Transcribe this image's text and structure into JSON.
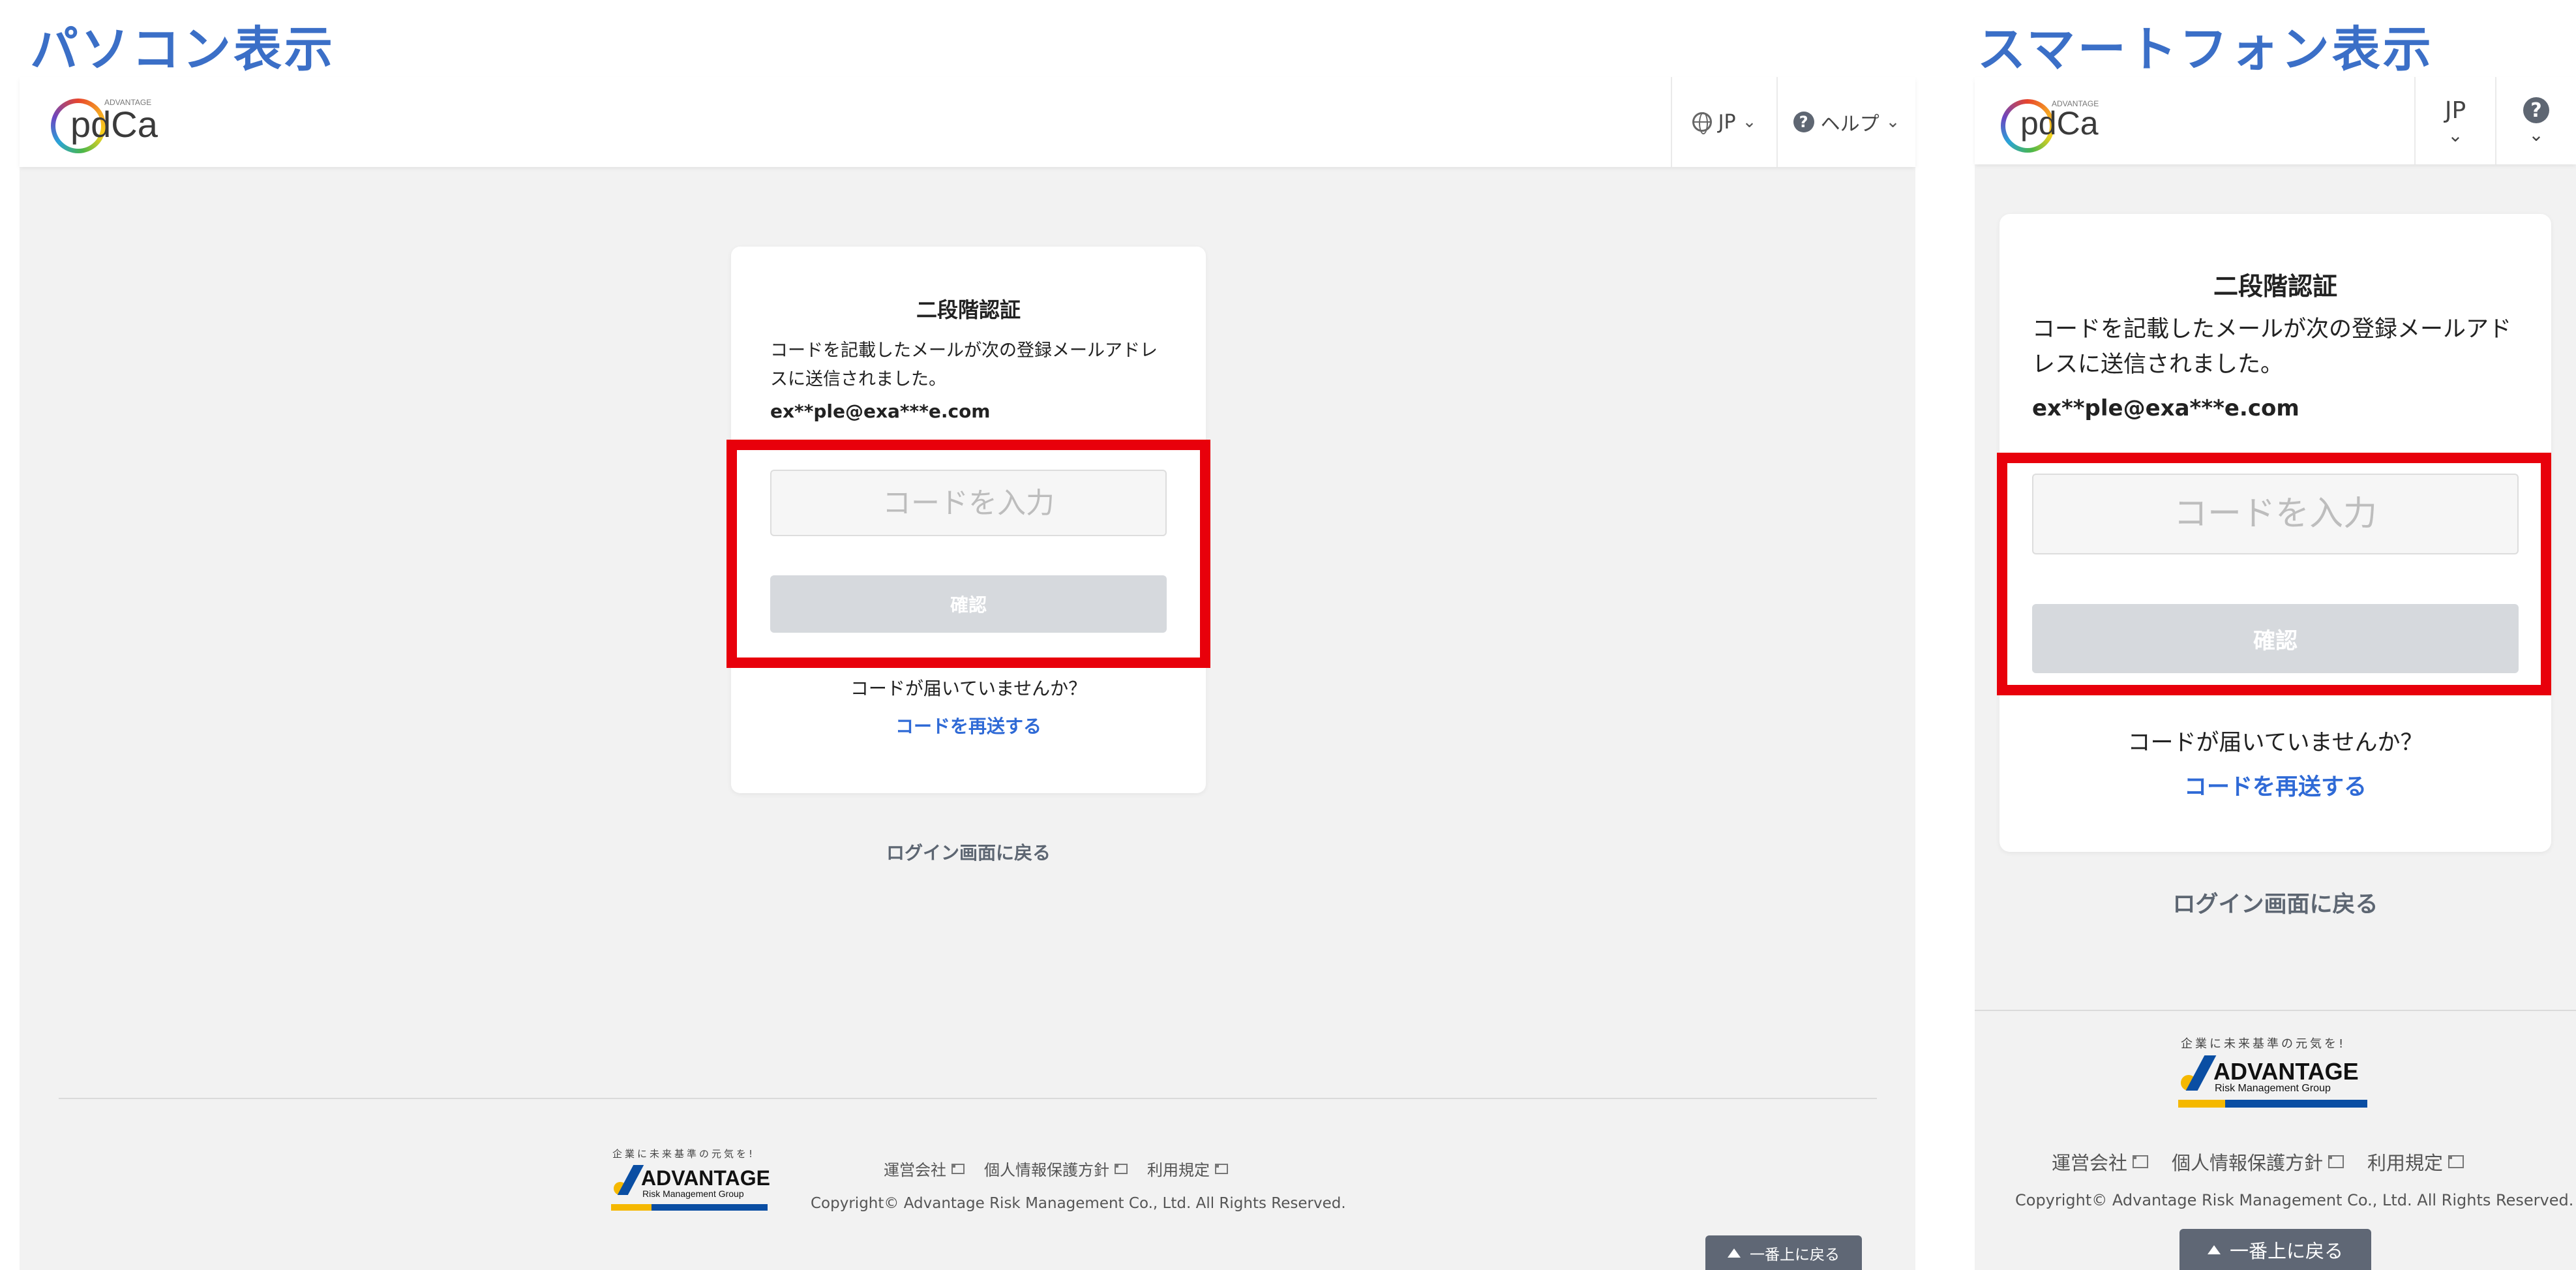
{
  "sections": {
    "pc_title": "パソコン表示",
    "sp_title": "スマートフォン表示"
  },
  "header": {
    "logo_text": "pdCa",
    "logo_tag": "ADVANTAGE",
    "language_label": "JP",
    "help_label": "ヘルプ",
    "help_icon_glyph": "?",
    "chevron_glyph": "⌄"
  },
  "auth": {
    "title": "二段階認証",
    "description": "コードを記載したメールが次の登録メールアドレスに送信されました。",
    "email": "ex**ple@exa***e.com",
    "code_placeholder": "コードを入力",
    "code_value": "",
    "confirm_label": "確認",
    "no_code_text": "コードが届いていませんか？",
    "resend_label": "コードを再送する",
    "back_to_login": "ログイン画面に戻る"
  },
  "footer": {
    "slogan": "企業に未来基準の元気を!",
    "brand": "ADVANTAGE",
    "brand_sub": "Risk Management Group",
    "links": [
      "運営会社",
      "個人情報保護方針",
      "利用規定"
    ],
    "copyright": "Copyright© Advantage Risk Management Co., Ltd. All Rights Reserved.",
    "to_top_label": "一番上に戻る"
  },
  "colors": {
    "accent": "#3b6fc7",
    "link": "#2f6ad6",
    "highlight": "#e8000b",
    "button_disabled": "#d6d9dd",
    "page_bg": "#f2f2f2"
  }
}
